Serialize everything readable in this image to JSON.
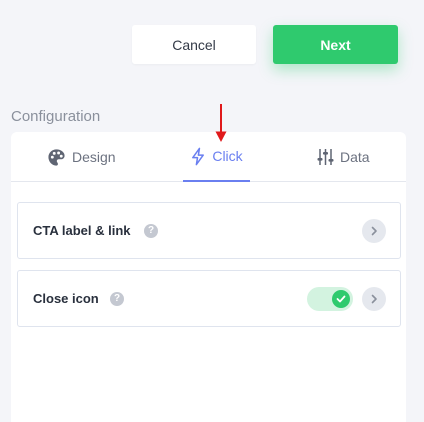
{
  "header": {
    "cancel_label": "Cancel",
    "next_label": "Next"
  },
  "section": {
    "title": "Configuration"
  },
  "tabs": [
    {
      "label": "Design",
      "icon": "palette-icon",
      "active": false
    },
    {
      "label": "Click",
      "icon": "lightning-icon",
      "active": true
    },
    {
      "label": "Data",
      "icon": "sliders-icon",
      "active": false
    }
  ],
  "rows": [
    {
      "label": "CTA label & link",
      "help": "?",
      "has_toggle": false
    },
    {
      "label": "Close icon",
      "help": "?",
      "has_toggle": true,
      "toggle_on": true
    }
  ],
  "colors": {
    "accent": "#6a7ff0",
    "primary_button": "#2fca6e",
    "annotation_arrow": "#e0191b"
  }
}
